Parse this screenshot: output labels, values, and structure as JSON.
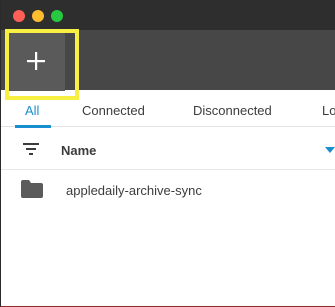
{
  "window": {
    "controls": [
      "close",
      "minimize",
      "maximize"
    ]
  },
  "toolbar": {
    "add_button_icon": "plus-icon",
    "add_button_highlight_color": "#f7f043"
  },
  "tabs": [
    {
      "label": "All",
      "active": true
    },
    {
      "label": "Connected",
      "active": false
    },
    {
      "label": "Disconnected",
      "active": false
    },
    {
      "label": "Lo",
      "active": false
    }
  ],
  "table": {
    "filter_icon": "filter-icon",
    "columns": [
      {
        "label": "Name"
      }
    ],
    "sort_icon": "sort-down-icon",
    "rows": [
      {
        "icon": "folder-icon",
        "name": "appledaily-archive-sync"
      }
    ]
  },
  "colors": {
    "accent": "#1a8fd0",
    "titlebar": "#2e2e2e",
    "toolbar": "#474747",
    "traffic_close": "#fe5f57",
    "traffic_min": "#febc2e",
    "traffic_max": "#28c840"
  }
}
